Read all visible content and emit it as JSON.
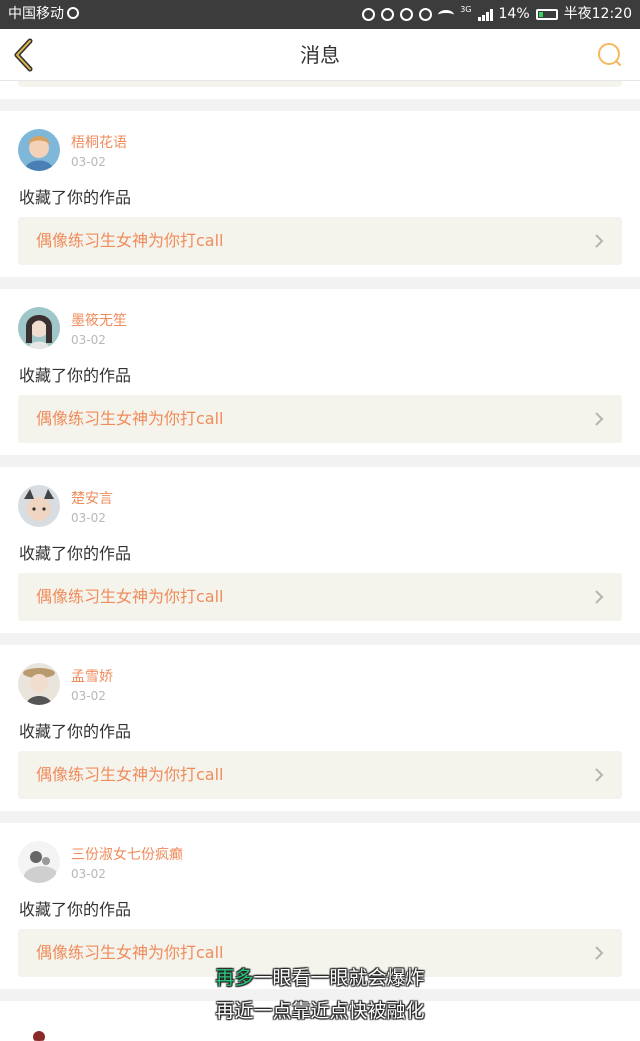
{
  "status_bar": {
    "carrier": "中国移动",
    "network": "3G",
    "battery": "14%",
    "time": "半夜12:20"
  },
  "nav": {
    "title": "消息",
    "back_icon": "chevron-left-icon",
    "search_icon": "search-icon"
  },
  "colors": {
    "accent": "#f08c5c",
    "card_link_bg": "#f4f4ec",
    "page_bg": "#f2f2f2"
  },
  "notifications": [
    {
      "username": "梧桐花语",
      "date": "03-02",
      "action": "收藏了你的作品",
      "work_title": "偶像练习生女神为你打call"
    },
    {
      "username": "墨筱无笙",
      "date": "03-02",
      "action": "收藏了你的作品",
      "work_title": "偶像练习生女神为你打call"
    },
    {
      "username": "楚安言",
      "date": "03-02",
      "action": "收藏了你的作品",
      "work_title": "偶像练习生女神为你打call"
    },
    {
      "username": "孟雪娇",
      "date": "03-02",
      "action": "收藏了你的作品",
      "work_title": "偶像练习生女神为你打call"
    },
    {
      "username": "三份淑女七份疯癫",
      "date": "03-02",
      "action": "收藏了你的作品",
      "work_title": "偶像练习生女神为你打call"
    }
  ],
  "subtitles": {
    "line1_highlight": "再多",
    "line1_rest": "一眼看一眼就会爆炸",
    "line2": "再近一点靠近点快被融化"
  }
}
